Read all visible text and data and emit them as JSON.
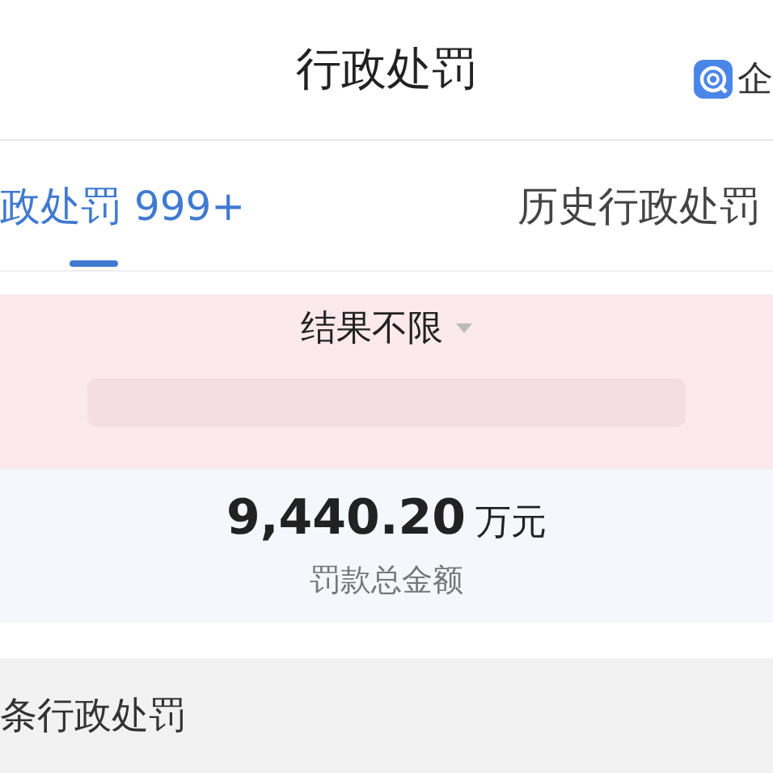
{
  "header": {
    "title": "行政处罚",
    "brand": "企"
  },
  "tabs": [
    {
      "label": "政处罚 999+",
      "selected": true
    },
    {
      "label": "历史行政处罚",
      "selected": false
    }
  ],
  "filter": {
    "label": "结果不限"
  },
  "summary": {
    "amount": "9,440.20",
    "unit": "万元",
    "caption": "罚款总金额"
  },
  "list_header": {
    "text": "条行政处罚"
  }
}
